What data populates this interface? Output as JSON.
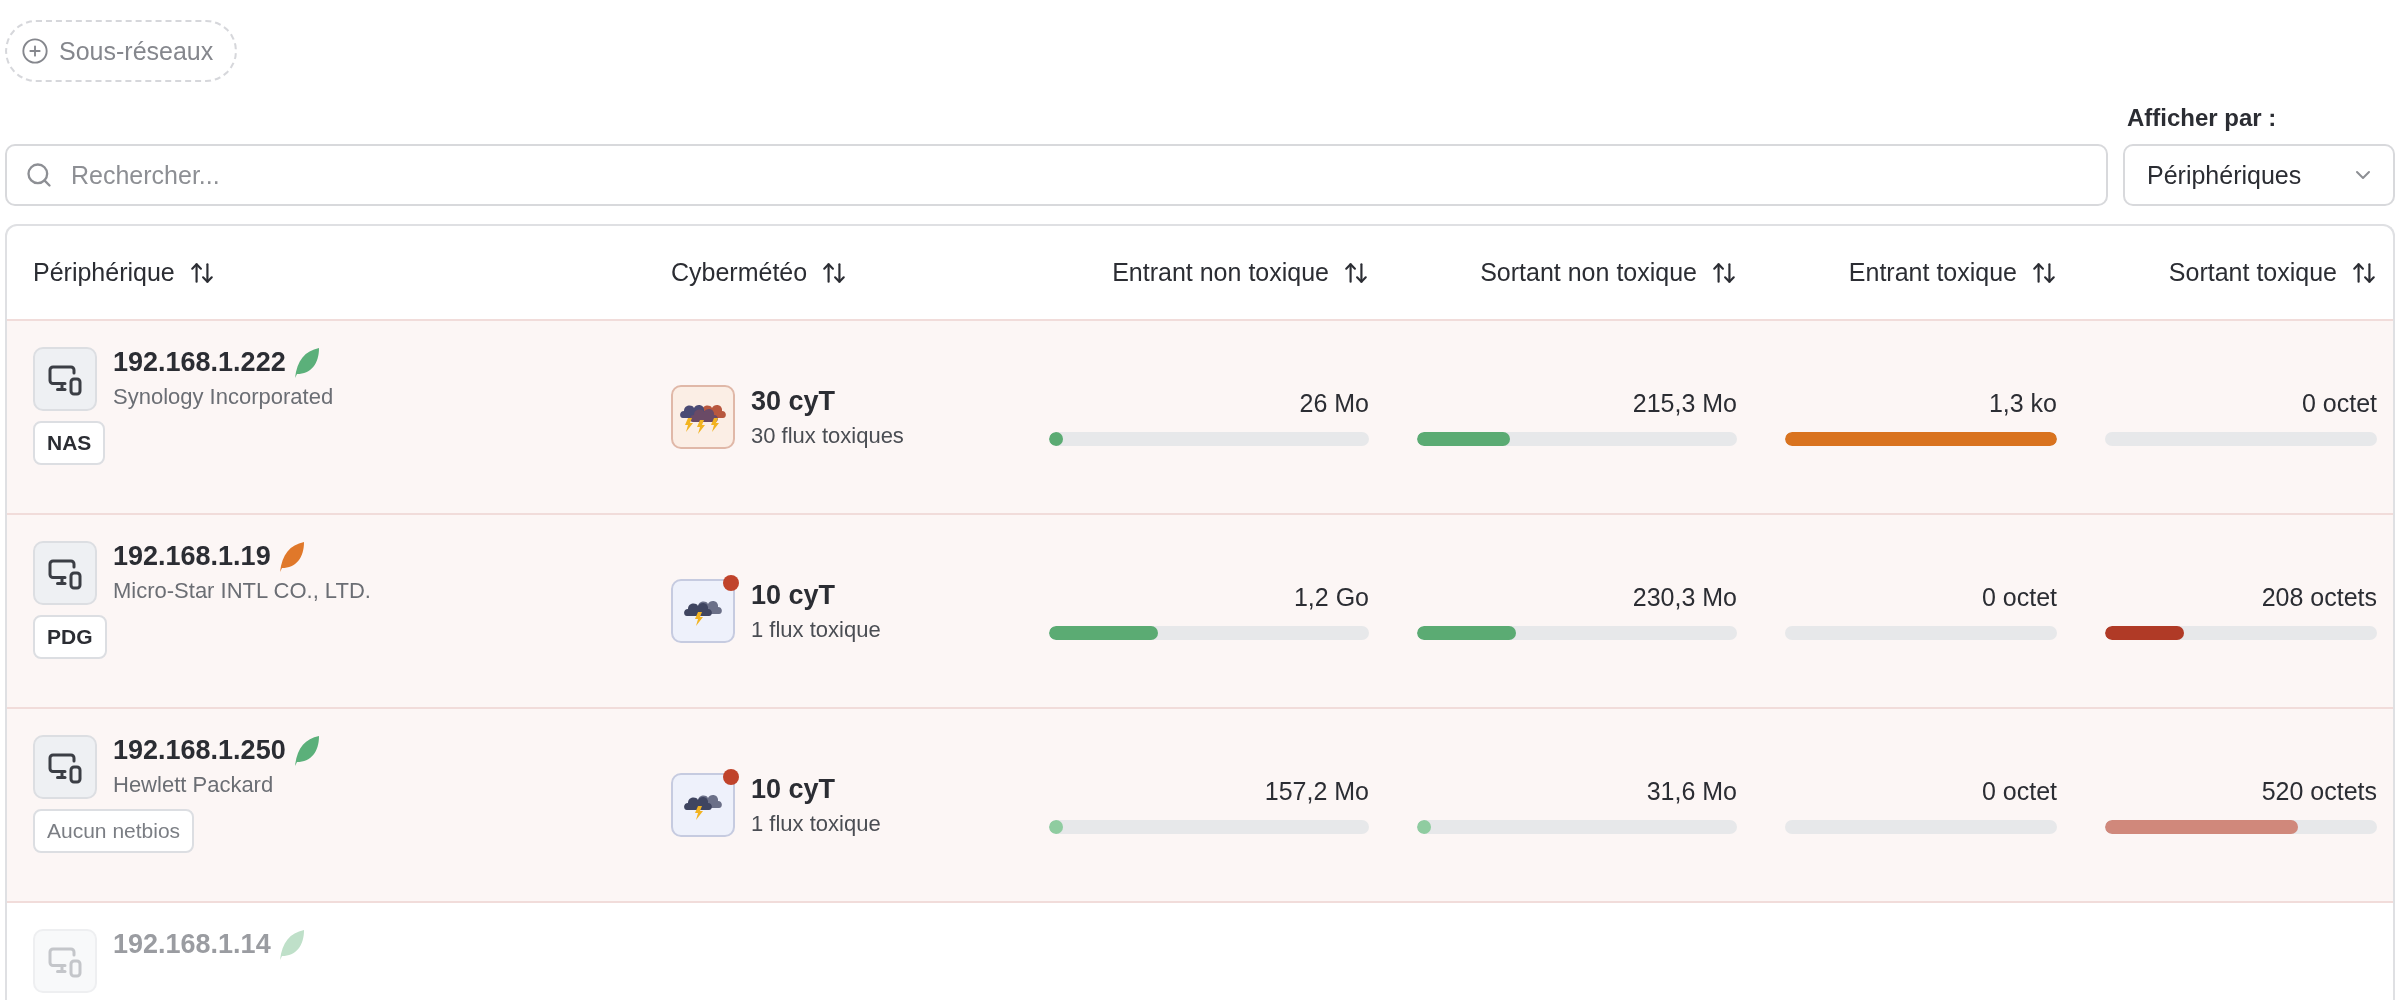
{
  "subnets_button": {
    "label": "Sous-réseaux"
  },
  "search": {
    "placeholder": "Rechercher..."
  },
  "view_by": {
    "label": "Afficher par :",
    "value": "Périphériques"
  },
  "table": {
    "columns": [
      "Périphérique",
      "Cybermétéo",
      "Entrant non toxique",
      "Sortant non toxique",
      "Entrant toxique",
      "Sortant toxique"
    ],
    "rows": [
      {
        "ip": "192.168.1.222",
        "leaf": {
          "color": "#5bb07a"
        },
        "vendor": "Synology Incorporated",
        "tag": "NAS",
        "tag_muted": false,
        "toxic": true,
        "weather": {
          "kind": "storm",
          "alert": false,
          "score": "30 cyT",
          "flows": "30 flux toxiques"
        },
        "traffic": [
          {
            "value": "26 Mo",
            "level": 0.01,
            "color": "#5bab73"
          },
          {
            "value": "215,3 Mo",
            "level": 0.29,
            "color": "#5bab73"
          },
          {
            "value": "1,3 ko",
            "level": 1,
            "color": "#d9731f"
          },
          {
            "value": "0 octet"
          }
        ]
      },
      {
        "ip": "192.168.1.19",
        "leaf": {
          "color": "#e0782a"
        },
        "vendor": "Micro-Star INTL CO., LTD.",
        "tag": "PDG",
        "tag_muted": false,
        "toxic": true,
        "weather": {
          "kind": "cloud",
          "alert": true,
          "score": "10 cyT",
          "flows": "1 flux toxique"
        },
        "traffic": [
          {
            "value": "1,2 Go",
            "level": 0.34,
            "color": "#5bab73"
          },
          {
            "value": "230,3 Mo",
            "level": 0.31,
            "color": "#5bab73"
          },
          {
            "value": "0 octet"
          },
          {
            "value": "208 octets",
            "level": 0.29,
            "color": "#b03a26"
          }
        ]
      },
      {
        "ip": "192.168.1.250",
        "leaf": {
          "color": "#5bb07a"
        },
        "vendor": "Hewlett Packard",
        "tag": "Aucun netbios",
        "tag_muted": true,
        "toxic": true,
        "weather": {
          "kind": "cloud",
          "alert": true,
          "score": "10 cyT",
          "flows": "1 flux toxique"
        },
        "traffic": [
          {
            "value": "157,2 Mo",
            "level": 0.03,
            "color": "#8fcca0"
          },
          {
            "value": "31,6 Mo",
            "level": 0.03,
            "color": "#8fcca0"
          },
          {
            "value": "0 octet"
          },
          {
            "value": "520 octets",
            "level": 0.71,
            "color": "#d0887b"
          }
        ]
      },
      {
        "ip": "192.168.1.14",
        "leaf": {
          "color": "#bfe0c9"
        },
        "toxic": false,
        "faded": true
      }
    ]
  }
}
